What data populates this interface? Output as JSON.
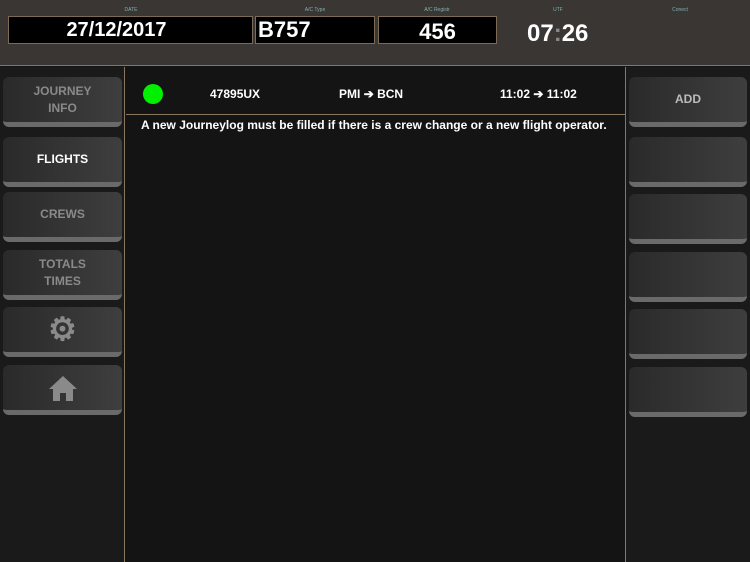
{
  "header": {
    "date_label": "DATE",
    "date": "27/12/2017",
    "type_label": "A/C Type",
    "type": "B757",
    "reg_label": "A/C Registr",
    "reg": "456",
    "utc_label": "UTF",
    "utc_h": "07",
    "utc_sep": ":",
    "utc_m": "26",
    "connect_label": "Conect"
  },
  "sidebar": {
    "items": [
      {
        "label": "JOURNEY INFO"
      },
      {
        "label": "FLIGHTS"
      },
      {
        "label": "CREWS"
      },
      {
        "label": "TOTALS TIMES"
      },
      {
        "icon": "gear-icon"
      },
      {
        "icon": "home-icon"
      }
    ],
    "active": "FLIGHTS"
  },
  "flight": {
    "status_color": "#00f000",
    "number": "47895UX",
    "from": "PMI",
    "to": "BCN",
    "dep": "11:02",
    "arr": "11:02",
    "arrow": "➔"
  },
  "note": "A new Journeylog must be filled if there is a crew change or a new flight operator.",
  "actions": {
    "add_label": "ADD"
  }
}
